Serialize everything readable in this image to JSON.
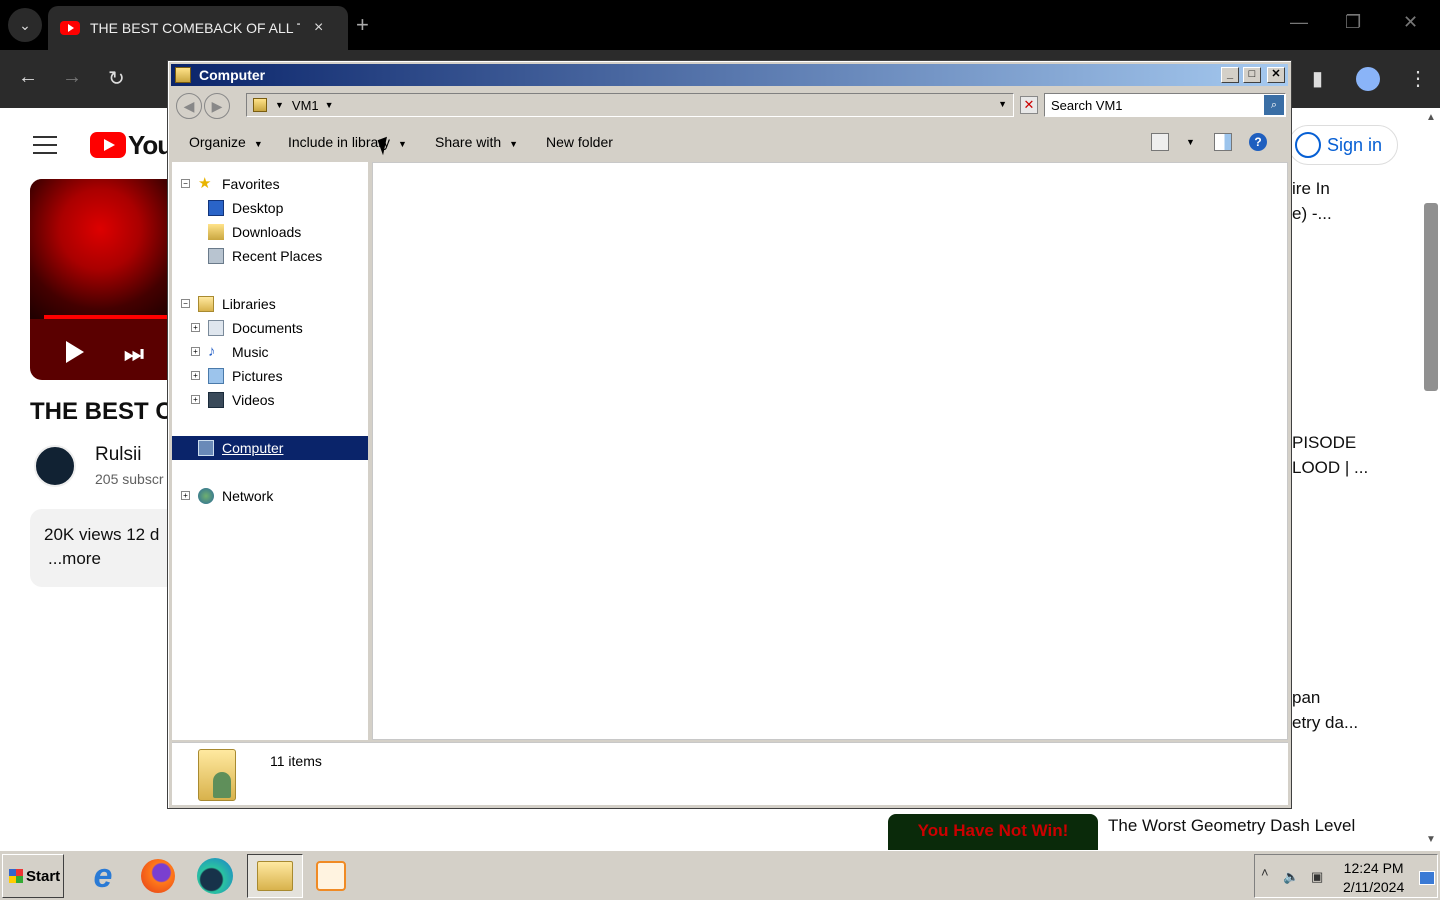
{
  "browser": {
    "tab_title": "THE BEST COMEBACK OF ALL TIM",
    "tab_close": "×",
    "new_tab": "+",
    "menu_glyph": "⌄"
  },
  "youtube": {
    "logo_text": "YouT",
    "video_title": "THE BEST C",
    "channel_name": "Rulsii",
    "subscribers": "205 subscr",
    "views_line": "20K views  12 d",
    "more": "...more",
    "sign_in": "Sign in",
    "side_items": [
      {
        "line1": "ire In",
        "line2": "e) -..."
      },
      {
        "line1": "PISODE",
        "line2": "LOOD | ..."
      },
      {
        "line1": "pan",
        "line2": "etry da..."
      }
    ],
    "rec_thumb_text": "You Have Not Win!",
    "rec_title": "The Worst Geometry Dash Level"
  },
  "explorer": {
    "title": "Computer",
    "address": "VM1",
    "search_placeholder": "Search VM1",
    "commands": {
      "organize": "Organize",
      "include": "Include in library",
      "share": "Share with",
      "new_folder": "New folder"
    },
    "tree": {
      "favorites": "Favorites",
      "desktop": "Desktop",
      "downloads": "Downloads",
      "recent": "Recent Places",
      "libraries": "Libraries",
      "documents": "Documents",
      "music": "Music",
      "pictures": "Pictures",
      "videos": "Videos",
      "computer": "Computer",
      "network": "Network"
    },
    "status_count": "11 items"
  },
  "taskbar": {
    "start": "Start",
    "time": "12:24 PM",
    "date": "2/11/2024"
  }
}
